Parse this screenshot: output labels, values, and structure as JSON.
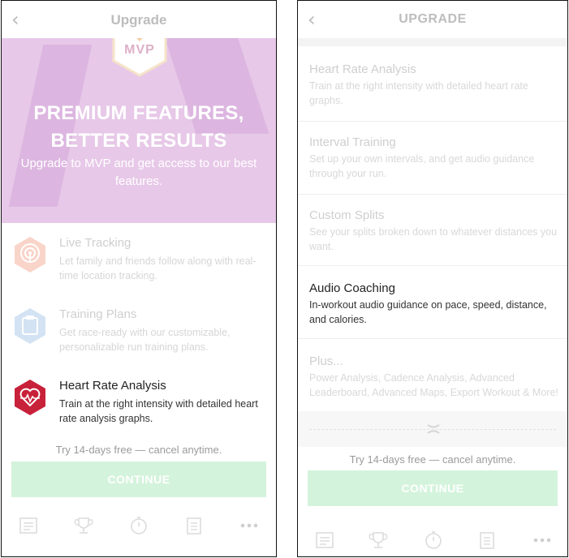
{
  "left": {
    "title": "Upgrade",
    "badge": "MVP",
    "hero_title_line1": "PREMIUM FEATURES,",
    "hero_title_line2": "BETTER RESULTS",
    "hero_sub": "Upgrade to MVP and get access to our best features.",
    "features": [
      {
        "title": "Live Tracking",
        "desc": "Let family and friends follow along with real-time location tracking.",
        "icon": "live-tracking-icon"
      },
      {
        "title": "Training Plans",
        "desc": "Get race-ready with our customizable, personalizable run training plans.",
        "icon": "training-plans-icon"
      },
      {
        "title": "Heart Rate Analysis",
        "desc": "Train at the right intensity with detailed heart rate analysis graphs.",
        "icon": "heart-rate-icon"
      }
    ],
    "trial": "Try 14-days free — cancel anytime.",
    "continue": "CONTINUE"
  },
  "right": {
    "title": "UPGRADE",
    "items": [
      {
        "title": "Heart Rate Analysis",
        "desc": "Train at the right intensity with detailed heart rate graphs."
      },
      {
        "title": "Interval Training",
        "desc": "Set up your own intervals, and get audio guidance through your run."
      },
      {
        "title": "Custom Splits",
        "desc": "See your splits broken down to whatever distances you want."
      },
      {
        "title": "Audio Coaching",
        "desc": "In-workout audio guidance on pace, speed, distance, and calories."
      },
      {
        "title": "Plus...",
        "desc": "Power Analysis, Cadence Analysis, Advanced Leaderboard, Advanced Maps, Export Workout & More!"
      }
    ],
    "trial": "Try 14-days free — cancel anytime.",
    "continue": "CONTINUE"
  },
  "tabs": [
    "feed-icon",
    "challenges-trophy-icon",
    "record-stopwatch-icon",
    "plans-clipboard-icon",
    "more-icon"
  ],
  "colors": {
    "hero_bg": "#e7c8e8",
    "continue_bg": "#d4f3dc",
    "heart_icon": "#c8213a",
    "live_tracking_icon": "#f7c5b8",
    "training_plans_icon": "#c9dcf0"
  }
}
